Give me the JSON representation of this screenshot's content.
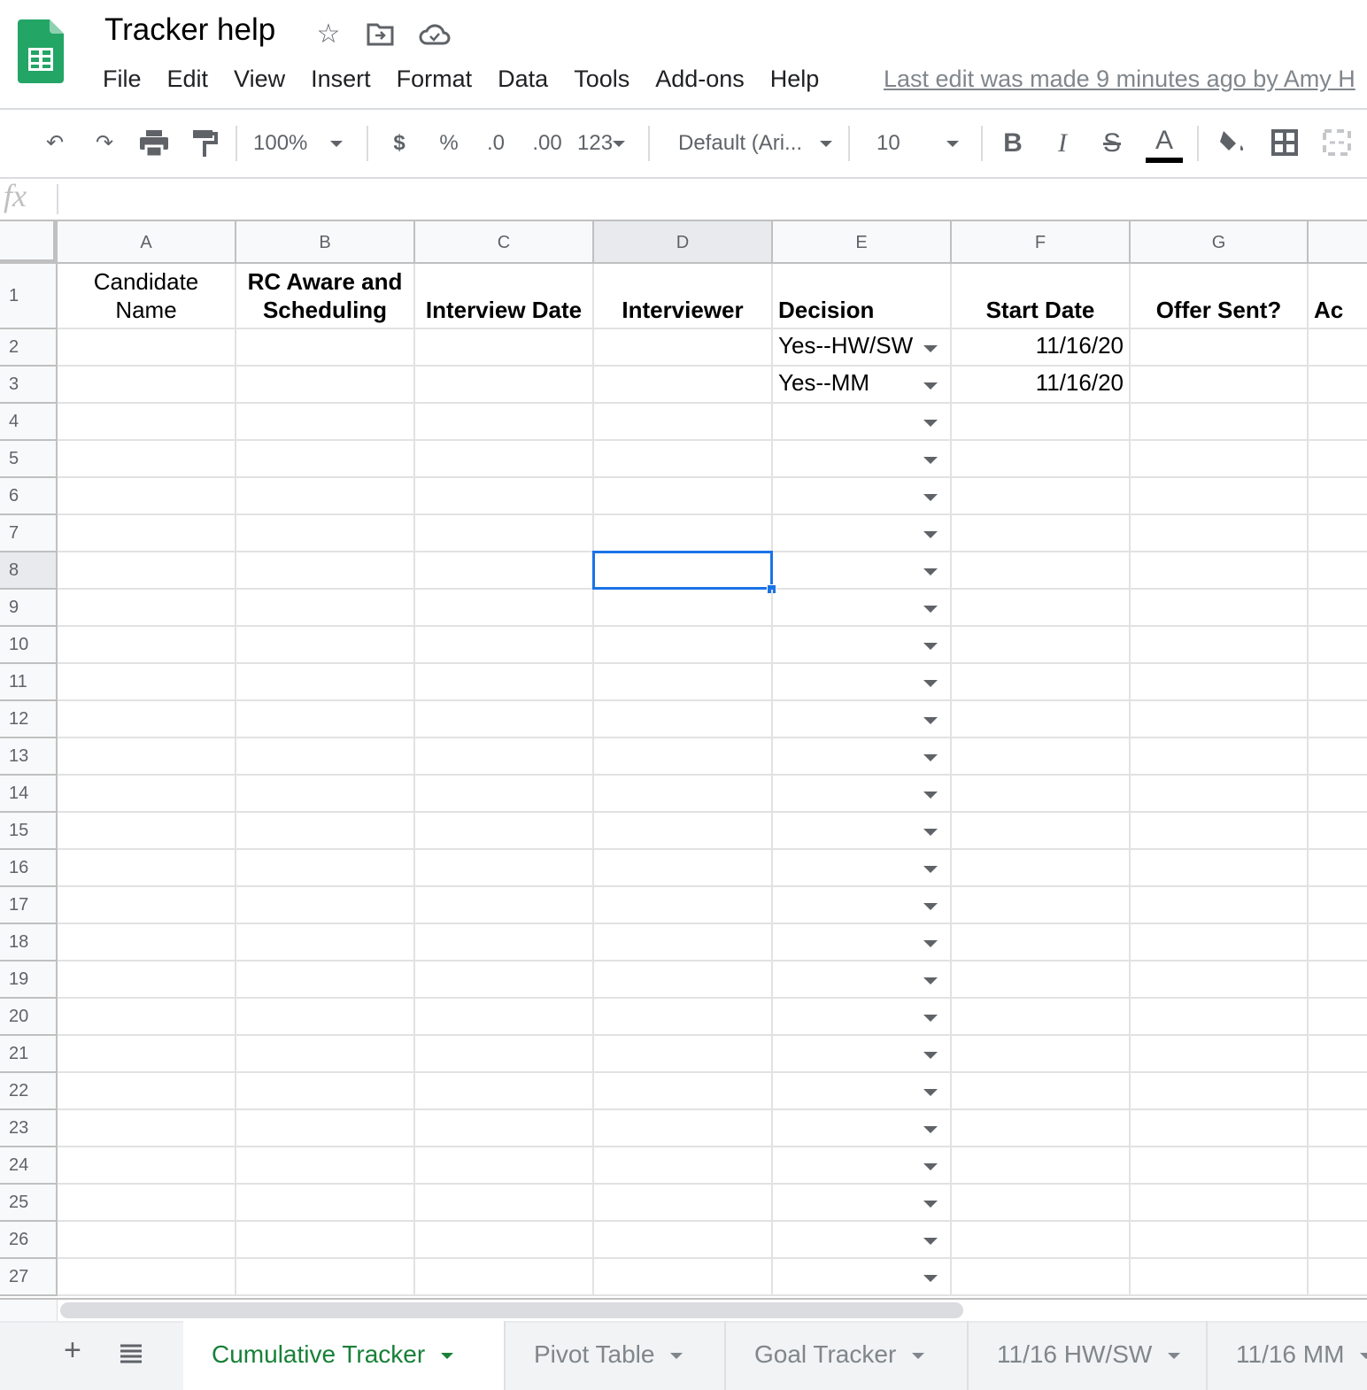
{
  "app": {
    "title": "Tracker help",
    "last_edit": "Last edit was made 9 minutes ago by Amy H",
    "brand_color": "#0f9d58"
  },
  "menu": [
    "File",
    "Edit",
    "View",
    "Insert",
    "Format",
    "Data",
    "Tools",
    "Add-ons",
    "Help"
  ],
  "toolbar": {
    "zoom": "100%",
    "currency": "$",
    "percent": "%",
    "dec_decrease": ".0",
    "dec_increase": ".00",
    "more_formats": "123",
    "font": "Default (Ari...",
    "font_size": "10",
    "bold": "B",
    "italic": "I",
    "strike": "S",
    "text_color": "A"
  },
  "formula_bar": {
    "fx": "fx",
    "value": ""
  },
  "columns": [
    "A",
    "B",
    "C",
    "D",
    "E",
    "F",
    "G",
    ""
  ],
  "selected_cell": "D8",
  "rows": [
    {
      "num": "1",
      "cells": [
        "Candidate Name",
        "RC Aware and Scheduling",
        "Interview Date",
        "Interviewer",
        "Decision",
        "Start Date",
        "Offer Sent?",
        "Ac"
      ]
    },
    {
      "num": "2",
      "cells": [
        "",
        "",
        "",
        "",
        "Yes--HW/SW",
        "11/16/20",
        "",
        ""
      ]
    },
    {
      "num": "3",
      "cells": [
        "",
        "",
        "",
        "",
        "Yes--MM",
        "11/16/20",
        "",
        ""
      ]
    },
    {
      "num": "4"
    },
    {
      "num": "5"
    },
    {
      "num": "6"
    },
    {
      "num": "7"
    },
    {
      "num": "8"
    },
    {
      "num": "9"
    },
    {
      "num": "10"
    },
    {
      "num": "11"
    },
    {
      "num": "12"
    },
    {
      "num": "13"
    },
    {
      "num": "14"
    },
    {
      "num": "15"
    },
    {
      "num": "16"
    },
    {
      "num": "17"
    },
    {
      "num": "18"
    },
    {
      "num": "19"
    },
    {
      "num": "20"
    },
    {
      "num": "21"
    },
    {
      "num": "22"
    },
    {
      "num": "23"
    },
    {
      "num": "24"
    },
    {
      "num": "25"
    },
    {
      "num": "26"
    },
    {
      "num": "27"
    }
  ],
  "sheets": [
    {
      "label": "Cumulative Tracker",
      "active": true
    },
    {
      "label": "Pivot Table"
    },
    {
      "label": "Goal Tracker"
    },
    {
      "label": "11/16 HW/SW"
    },
    {
      "label": "11/16 MM"
    }
  ]
}
